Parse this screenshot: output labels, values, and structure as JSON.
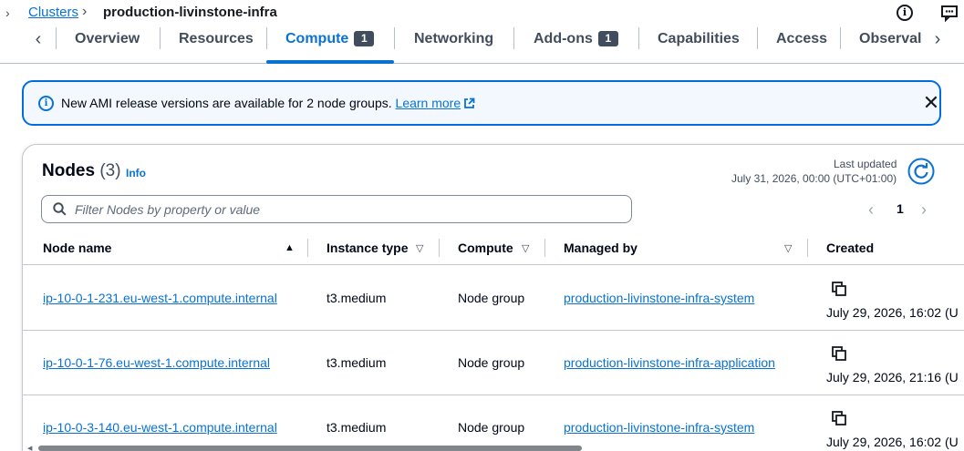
{
  "breadcrumb": {
    "parent": "Clusters",
    "current": "production-livinstone-infra"
  },
  "tabs": [
    {
      "label": "Overview"
    },
    {
      "label": "Resources"
    },
    {
      "label": "Compute",
      "badge": "1",
      "active": true
    },
    {
      "label": "Networking"
    },
    {
      "label": "Add-ons",
      "badge": "1"
    },
    {
      "label": "Capabilities"
    },
    {
      "label": "Access"
    },
    {
      "label": "Observal"
    }
  ],
  "flash": {
    "message": "New AMI release versions are available for 2 node groups.",
    "link": "Learn more"
  },
  "nodes": {
    "title": "Nodes",
    "count": "(3)",
    "info": "Info",
    "last_updated_label": "Last updated",
    "last_updated_value": "July 31, 2026, 00:00 (UTC+01:00)",
    "filter_placeholder": "Filter Nodes by property or value",
    "page": "1",
    "columns": [
      "Node name",
      "Instance type",
      "Compute",
      "Managed by",
      "Created"
    ],
    "rows": [
      {
        "name": "ip-10-0-1-231.eu-west-1.compute.internal",
        "instance_type": "t3.medium",
        "compute": "Node group",
        "managed_by": "production-livinstone-infra-system",
        "created": "July 29, 2026, 16:02 (U"
      },
      {
        "name": "ip-10-0-1-76.eu-west-1.compute.internal",
        "instance_type": "t3.medium",
        "compute": "Node group",
        "managed_by": "production-livinstone-infra-application",
        "created": "July 29, 2026, 21:16 (U"
      },
      {
        "name": "ip-10-0-3-140.eu-west-1.compute.internal",
        "instance_type": "t3.medium",
        "compute": "Node group",
        "managed_by": "production-livinstone-infra-system",
        "created": "July 29, 2026, 16:02 (U"
      }
    ]
  },
  "colors": {
    "link": "#0972d3",
    "flash_border": "#006ce0",
    "flash_bg": "#f2f8fd",
    "badge_bg": "#414d5c"
  }
}
